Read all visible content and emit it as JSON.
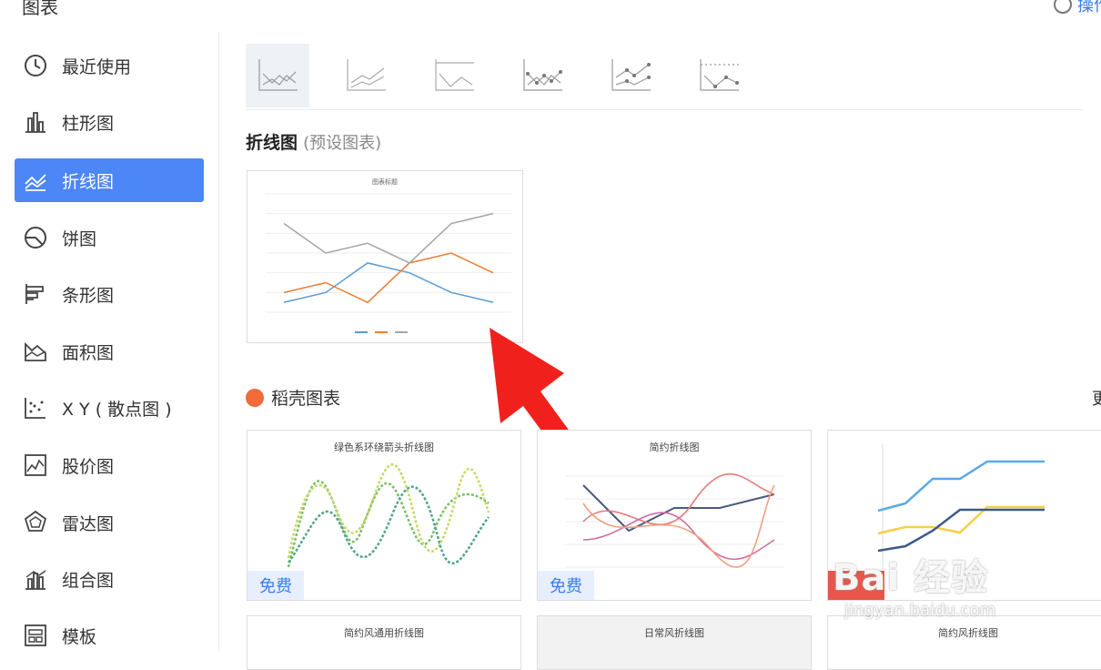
{
  "header": {
    "title": "图表",
    "help_label": "操作"
  },
  "sidebar": {
    "items": [
      {
        "label": "最近使用",
        "icon": "clock-icon"
      },
      {
        "label": "柱形图",
        "icon": "bar-chart-icon"
      },
      {
        "label": "折线图",
        "icon": "line-chart-icon"
      },
      {
        "label": "饼图",
        "icon": "pie-chart-icon"
      },
      {
        "label": "条形图",
        "icon": "horizontal-bar-icon"
      },
      {
        "label": "面积图",
        "icon": "area-chart-icon"
      },
      {
        "label": "X Y ( 散点图 )",
        "icon": "scatter-icon"
      },
      {
        "label": "股价图",
        "icon": "stock-chart-icon"
      },
      {
        "label": "雷达图",
        "icon": "radar-chart-icon"
      },
      {
        "label": "组合图",
        "icon": "combo-chart-icon"
      },
      {
        "label": "模板",
        "icon": "template-icon"
      }
    ],
    "active_index": 2,
    "accent": "#4d86f7"
  },
  "preset_section": {
    "title": "折线图",
    "subtitle": "(预设图表)",
    "chart_title": "图表标题"
  },
  "daoke_section": {
    "title": "稻壳图表",
    "more": "更"
  },
  "cards": [
    {
      "title": "绿色系环绕箭头折线图",
      "badge": "免费"
    },
    {
      "title": "简约折线图",
      "badge": "免费"
    },
    {
      "title": "",
      "badge": ""
    },
    {
      "title": "简约风通用折线图",
      "badge": ""
    },
    {
      "title": "日常风折线图",
      "badge": ""
    },
    {
      "title": "简约风折线图",
      "badge": ""
    }
  ],
  "watermark": {
    "main": "Bai 经验",
    "sub": "jingyan.baidu.com"
  },
  "chart_data": {
    "type": "line",
    "x": [
      1,
      2,
      3,
      4,
      5,
      6
    ],
    "series": [
      {
        "values": [
          1,
          2,
          5,
          4,
          2,
          1
        ],
        "color": "#5b9bd5"
      },
      {
        "values": [
          2,
          3,
          1,
          5,
          6,
          4
        ],
        "color": "#ed7d31"
      },
      {
        "values": [
          9,
          6,
          7,
          5,
          9,
          10
        ],
        "color": "#a5a5a5"
      }
    ],
    "ylim": [
      0,
      12
    ]
  }
}
